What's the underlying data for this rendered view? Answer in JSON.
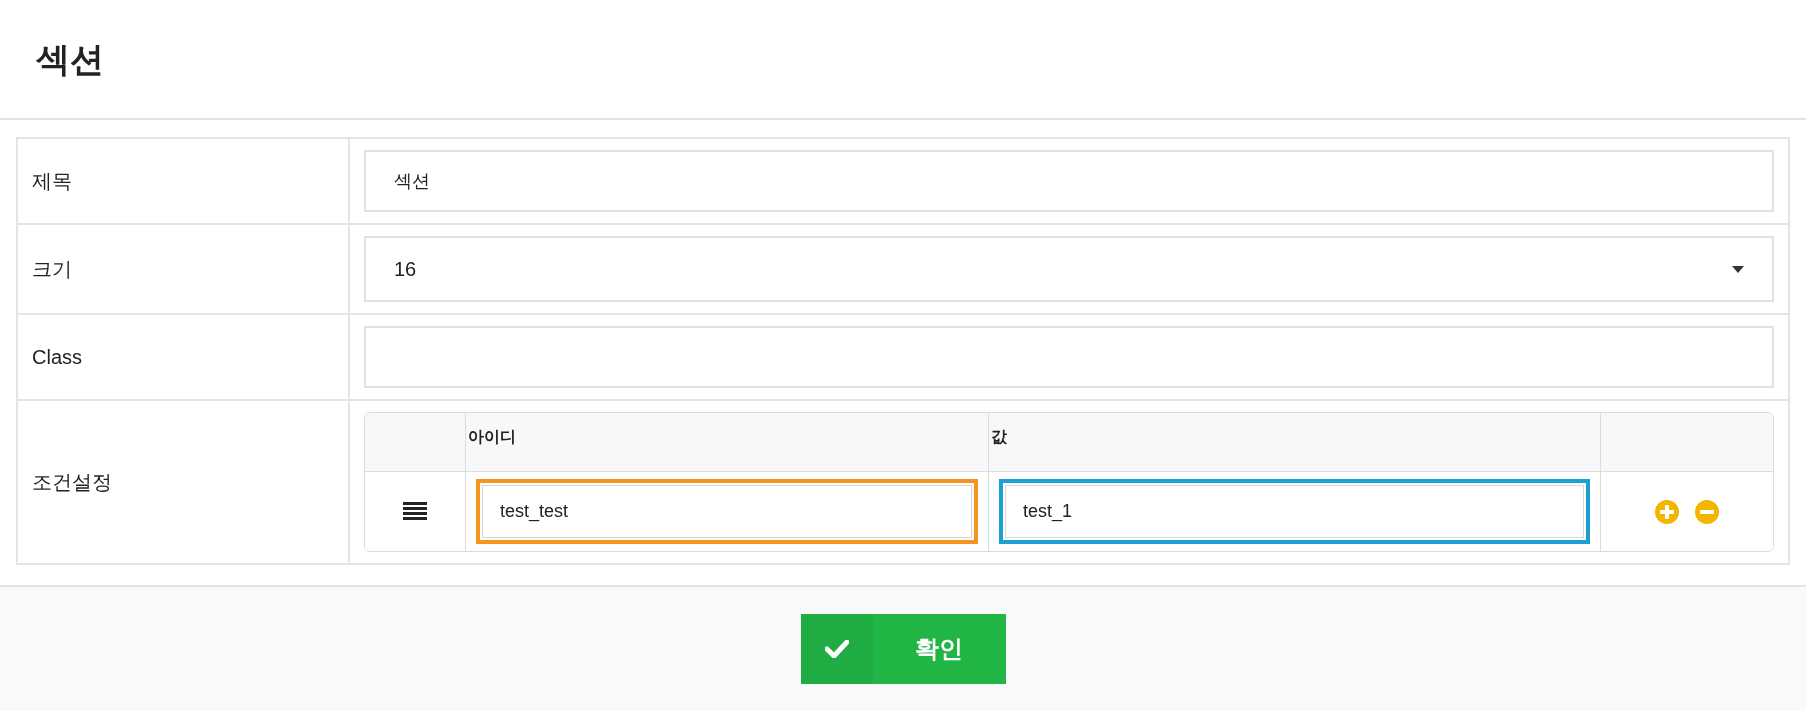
{
  "title": "섹션",
  "form": [
    {
      "label": "제목",
      "kind": "text",
      "value": "섹션"
    },
    {
      "label": "크기",
      "kind": "select",
      "value": "16"
    },
    {
      "label": "Class",
      "kind": "text"
    },
    {
      "label": "조건설정",
      "kind": "conditions"
    }
  ],
  "conditions": {
    "columns": [
      "아이디",
      "값"
    ],
    "rows": [
      {
        "fields": [
          {
            "value": "test_test",
            "color": "#f7941d"
          },
          {
            "value": "test_1",
            "color": "#1ba1d1"
          }
        ]
      }
    ]
  },
  "confirm_button": "확인"
}
